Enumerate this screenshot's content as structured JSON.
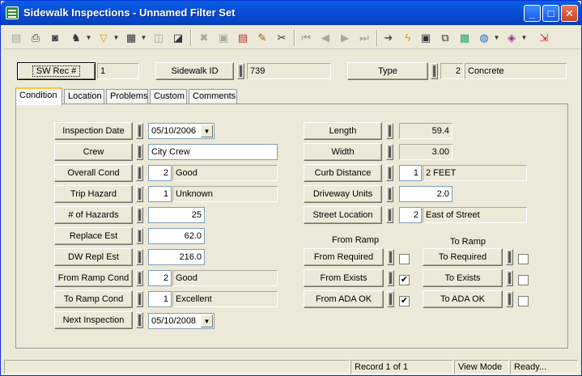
{
  "window": {
    "title": "Sidewalk Inspections - Unnamed Filter Set"
  },
  "header": {
    "sw_rec_label": "SW Rec #",
    "sw_rec_value": "1",
    "sidewalk_id_label": "Sidewalk ID",
    "sidewalk_id_value": "739",
    "type_label": "Type",
    "type_code": "2",
    "type_value": "Concrete"
  },
  "tabs": [
    "Condition",
    "Location",
    "Problems",
    "Custom",
    "Comments"
  ],
  "left": {
    "inspection_date": {
      "label": "Inspection Date",
      "value": "05/10/2006"
    },
    "crew": {
      "label": "Crew",
      "value": "City Crew"
    },
    "overall_cond": {
      "label": "Overall Cond",
      "code": "2",
      "value": "Good"
    },
    "trip_hazard": {
      "label": "Trip Hazard",
      "code": "1",
      "value": "Unknown"
    },
    "num_hazards": {
      "label": "# of Hazards",
      "value": "25"
    },
    "replace_est": {
      "label": "Replace Est",
      "value": "62.0"
    },
    "dw_repl_est": {
      "label": "DW Repl Est",
      "value": "216.0"
    },
    "from_ramp_cond": {
      "label": "From Ramp Cond",
      "code": "2",
      "value": "Good"
    },
    "to_ramp_cond": {
      "label": "To Ramp Cond",
      "code": "1",
      "value": "Excellent"
    },
    "next_inspection": {
      "label": "Next Inspection",
      "value": "05/10/2008"
    }
  },
  "right": {
    "length": {
      "label": "Length",
      "value": "59.4"
    },
    "width": {
      "label": "Width",
      "value": "3.00"
    },
    "curb_distance": {
      "label": "Curb Distance",
      "code": "1",
      "value": "2 FEET"
    },
    "driveway_units": {
      "label": "Driveway Units",
      "value": "2.0"
    },
    "street_location": {
      "label": "Street Location",
      "code": "2",
      "value": "East of Street"
    }
  },
  "ramps": {
    "from_heading": "From Ramp",
    "to_heading": "To Ramp",
    "from_required": {
      "label": "From Required",
      "checked": false
    },
    "from_exists": {
      "label": "From Exists",
      "checked": true
    },
    "from_ada_ok": {
      "label": "From ADA OK",
      "checked": true
    },
    "to_required": {
      "label": "To Required",
      "checked": false
    },
    "to_exists": {
      "label": "To  Exists",
      "checked": false
    },
    "to_ada_ok": {
      "label": "To ADA OK",
      "checked": false
    }
  },
  "status": {
    "record": "Record 1 of 1",
    "mode": "View Mode",
    "state": "Ready..."
  },
  "glyphs": {
    "check": "✔",
    "dropdown": "▼"
  }
}
